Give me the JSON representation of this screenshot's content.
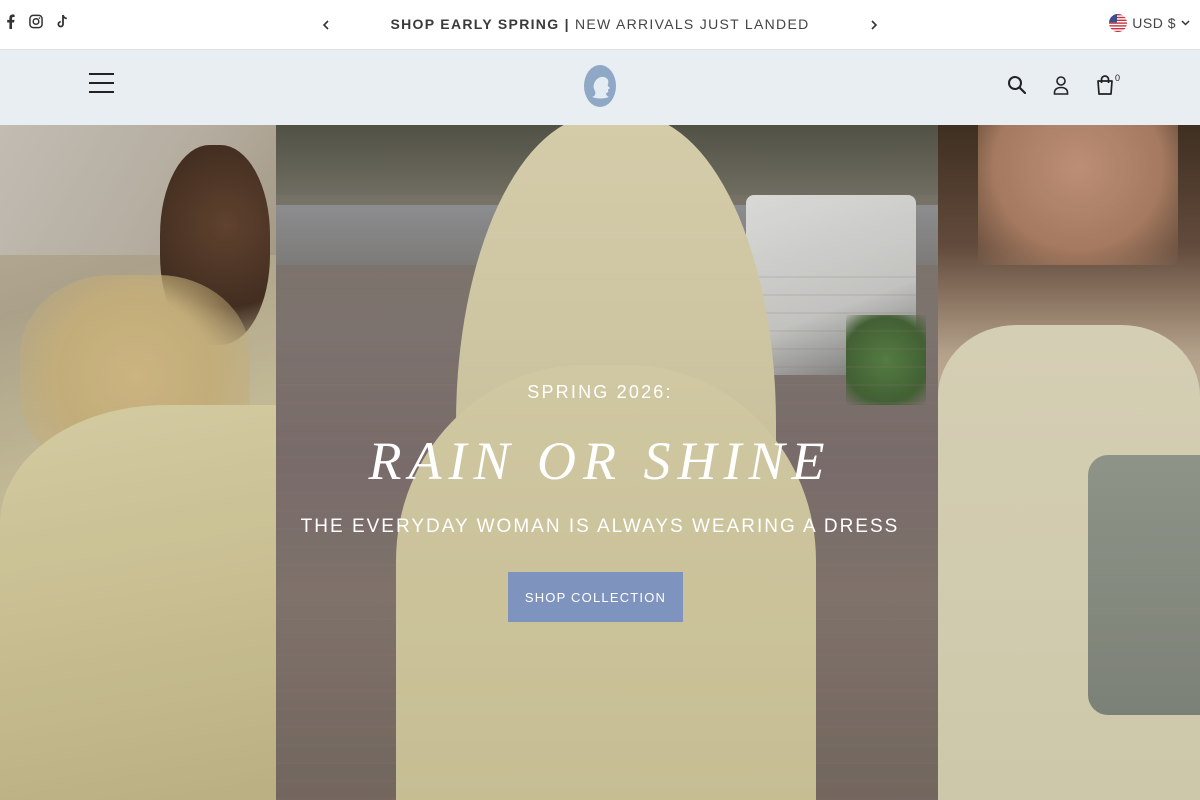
{
  "announcement": {
    "bold": "SHOP EARLY SPRING |",
    "text": " NEW ARRIVALS JUST LANDED"
  },
  "socials": [
    "facebook-icon",
    "instagram-icon",
    "tiktok-icon"
  ],
  "currency": {
    "label": "USD $"
  },
  "header": {
    "cart_count": "0",
    "icons": [
      "menu-icon",
      "search-icon",
      "account-icon",
      "cart-icon"
    ]
  },
  "hero": {
    "subtitle": "SPRING 2026:",
    "title": "RAIN OR SHINE",
    "tagline": "THE EVERYDAY WOMAN IS ALWAYS WEARING A DRESS",
    "cta": "SHOP COLLECTION"
  },
  "colors": {
    "header_bg": "#e9eef3",
    "cta_bg": "#7f93bf",
    "logo": "#8fa8c6"
  }
}
